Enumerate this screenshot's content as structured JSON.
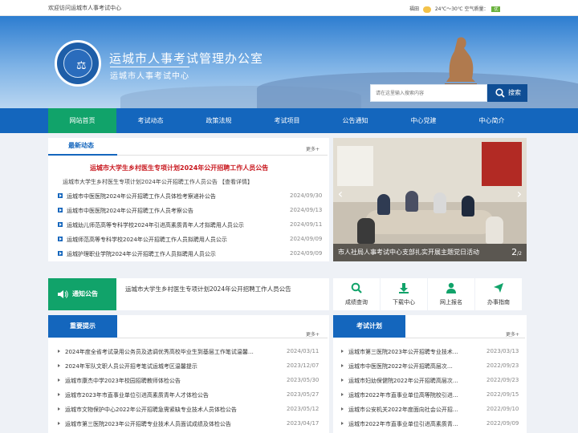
{
  "topbar": {
    "welcome": "欢迎访问运城市人事考试中心",
    "city": "福田",
    "temp": "24℃～30℃",
    "aq_label": "空气质量：",
    "aq_value": "优"
  },
  "header": {
    "title": "运城市人事考试管理办公室",
    "subtitle": "运城市人事考试中心"
  },
  "search": {
    "placeholder": "请在这里输入搜索内容",
    "button": "搜索"
  },
  "nav": [
    "网站首页",
    "考试动态",
    "政策法规",
    "考试项目",
    "公告通知",
    "中心党建",
    "中心简介"
  ],
  "news": {
    "title": "最新动态",
    "more": "更多+",
    "headline": "运城市大学生乡村医生专项计划2024年公开招聘工作人员公告",
    "summary": "运城市大学生乡村医生专项计划2024年公开招聘工作人员公告 【查看详情】",
    "items": [
      {
        "text": "运城市中医医院2024年公开招聘工作人员体检考察递补公告",
        "date": "2024/09/30"
      },
      {
        "text": "运城市中医医院2024年公开招聘工作人员考察公告",
        "date": "2024/09/13"
      },
      {
        "text": "运城幼儿师范高等专科学校2024年引进高素质青年人才拟聘用人员公示",
        "date": "2024/09/11"
      },
      {
        "text": "运城师范高等专科学校2024年公开招聘工作人员拟聘用人员公示",
        "date": "2024/09/09"
      },
      {
        "text": "运城护理职业学院2024年公开招聘工作人员拟聘用人员公示",
        "date": "2024/09/09"
      }
    ]
  },
  "slide": {
    "caption": "市人社局人事考试中心支部扎实开展主题党日活动",
    "current": "2",
    "total": "/2"
  },
  "notice": {
    "label": "通知公告",
    "text": "运城市大学生乡村医生专项计划2024年公开招聘工作人员公告"
  },
  "quick": [
    {
      "label": "成绩查询",
      "icon": "search-icon"
    },
    {
      "label": "下载中心",
      "icon": "download-icon"
    },
    {
      "label": "网上报名",
      "icon": "user-icon"
    },
    {
      "label": "办事指南",
      "icon": "paper-plane-icon"
    }
  ],
  "reminders": {
    "title": "重要提示",
    "more": "更多+",
    "items": [
      {
        "text": "2024年度全省考试录用公务员及选调优秀高校毕业生到基层工作笔试温馨…",
        "date": "2024/03/11"
      },
      {
        "text": "2024年军队文职人员公开招考笔试运城考区温馨提示",
        "date": "2023/12/07"
      },
      {
        "text": "运城市康杰中学2023年校园招聘教师体检公告",
        "date": "2023/05/30"
      },
      {
        "text": "运城市2023年市直事业单位引进高素质青年人才体检公告",
        "date": "2023/05/27"
      },
      {
        "text": "运城市文物保护中心2022年公开招聘急需紧缺专业技术人员体检公告",
        "date": "2023/05/12"
      },
      {
        "text": "运城市第三医院2023年公开招聘专业技术人员面试成绩及体检公告",
        "date": "2023/04/17"
      }
    ]
  },
  "plans": {
    "title": "考试计划",
    "more": "更多+",
    "items": [
      {
        "text": "运城市第三医院2023年公开招聘专业技术…",
        "date": "2023/03/13"
      },
      {
        "text": "运城市中医医院2022年公开招聘高层次…",
        "date": "2022/09/23"
      },
      {
        "text": "运城市妇幼保健院2022年公开招聘高层次…",
        "date": "2022/09/23"
      },
      {
        "text": "运城市2022年市直事业单位高等院校引进…",
        "date": "2022/09/15"
      },
      {
        "text": "运城市公安机关2022年度面向社会公开招…",
        "date": "2022/09/10"
      },
      {
        "text": "运城市2022年市直事业单位引进高素质青…",
        "date": "2022/09/09"
      }
    ]
  }
}
